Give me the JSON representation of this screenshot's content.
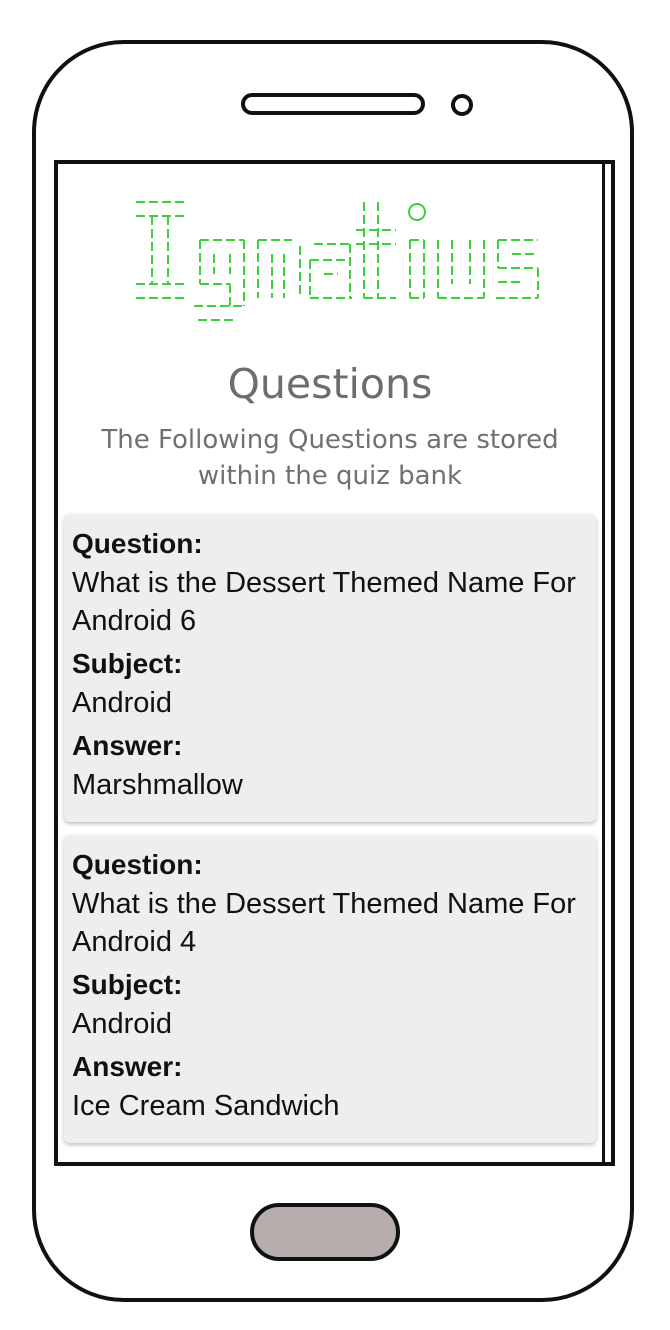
{
  "app": {
    "logo_text": "Ignatius",
    "logo_color": "#3ad13a"
  },
  "header": {
    "title": "Questions",
    "subtitle": "The Following Questions are stored within the quiz bank"
  },
  "labels": {
    "question": "Question:",
    "subject": "Subject:",
    "answer": "Answer:"
  },
  "questions": [
    {
      "question": "What is the Dessert Themed Name For Android 6",
      "subject": "Android",
      "answer": "Marshmallow"
    },
    {
      "question": "What is the Dessert Themed Name For Android 4",
      "subject": "Android",
      "answer": "Ice Cream Sandwich"
    }
  ],
  "colors": {
    "card_bg": "#eeeeee",
    "title_gray": "#6d6d6d",
    "home_button": "#b6aeac"
  },
  "icons": [
    "speaker-grille",
    "front-camera",
    "home-button"
  ]
}
